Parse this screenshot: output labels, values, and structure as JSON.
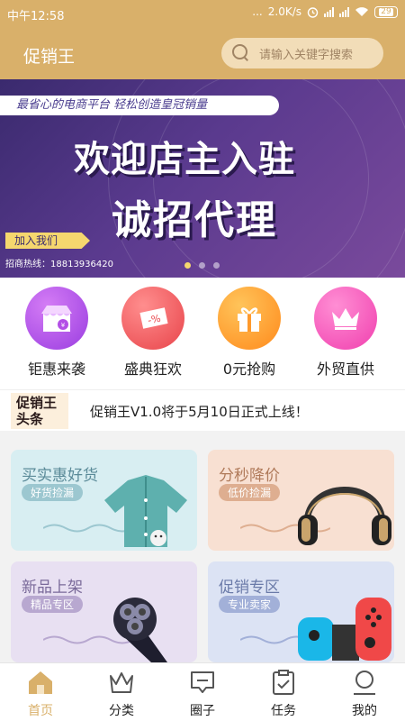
{
  "status_bar": {
    "time": "中午12:58",
    "dots": "...",
    "speed": "2.0K/s",
    "battery": "29"
  },
  "header": {
    "title": "促销王",
    "search_placeholder": "请输入关键字搜索"
  },
  "banner": {
    "tagline": "最省心的电商平台 轻松创造皇冠销量",
    "line1": "欢迎店主入驻",
    "line2": "诚招代理",
    "cta": "加入我们",
    "hotline": "招商热线：18813936420",
    "page_count": 3,
    "active_page": 1
  },
  "categories": [
    {
      "label": "钜惠来袭",
      "icon": "store-icon",
      "color_start": "#c85cf0",
      "color_end": "#9a3de0"
    },
    {
      "label": "盛典狂欢",
      "icon": "coupon-icon",
      "color_start": "#f7787a",
      "color_end": "#e8444a"
    },
    {
      "label": "0元抢购",
      "icon": "gift-icon",
      "color_start": "#ffb43a",
      "color_end": "#ff8a1c"
    },
    {
      "label": "外贸直供",
      "icon": "crown-icon",
      "color_start": "#ff72c8",
      "color_end": "#f03fae"
    }
  ],
  "news": {
    "logo": "促销王头条",
    "text": "促销王V1.0将于5月10日正式上线！"
  },
  "promos": [
    {
      "title": "买实惠好货",
      "badge": "好货捡漏",
      "title_color": "#5a8a98",
      "badge_color": "#9cc7d0",
      "bg": "#d8eef2",
      "product": "jacket"
    },
    {
      "title": "分秒降价",
      "badge": "低价捡漏",
      "title_color": "#b07a5a",
      "badge_color": "#deae90",
      "bg": "#f8e0d2",
      "product": "headphones"
    },
    {
      "title": "新品上架",
      "badge": "精品专区",
      "title_color": "#7a6a9a",
      "badge_color": "#b8a8d0",
      "bg": "#e8e0f2",
      "product": "shaver"
    },
    {
      "title": "促销专区",
      "badge": "专业卖家",
      "title_color": "#6a7aa8",
      "badge_color": "#a2b0d8",
      "bg": "#dce3f4",
      "product": "controller"
    }
  ],
  "tabs": [
    {
      "label": "首页",
      "icon": "home-icon",
      "active": true
    },
    {
      "label": "分类",
      "icon": "crown-outline-icon",
      "active": false
    },
    {
      "label": "圈子",
      "icon": "chat-icon",
      "active": false
    },
    {
      "label": "任务",
      "icon": "clipboard-check-icon",
      "active": false
    },
    {
      "label": "我的",
      "icon": "user-icon",
      "active": false
    }
  ],
  "colors": {
    "brand": "#d9b06a",
    "banner": "#4a3578"
  }
}
